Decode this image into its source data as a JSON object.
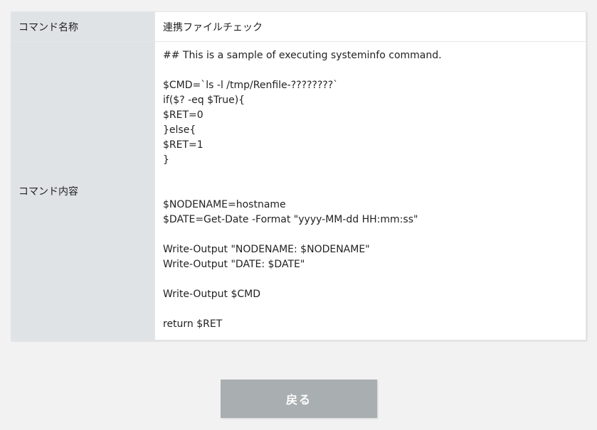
{
  "table": {
    "rows": [
      {
        "label": "コマンド名称",
        "value": "連携ファイルチェック"
      },
      {
        "label": "コマンド内容",
        "value": "## This is a sample of executing systeminfo command.\n\n$CMD=`ls -l /tmp/Renfile-????????`\nif($? -eq $True){\n$RET=0\n}else{\n$RET=1\n}\n\n\n$NODENAME=hostname\n$DATE=Get-Date -Format \"yyyy-MM-dd HH:mm:ss\"\n\nWrite-Output \"NODENAME: $NODENAME\"\nWrite-Output \"DATE: $DATE\"\n\nWrite-Output $CMD\n\nreturn $RET"
      }
    ]
  },
  "back_button": {
    "label": "戻る"
  },
  "colors": {
    "page_background": "#f2f2f2",
    "label_background": "#dfe3e6",
    "button_background": "#a9aeb0"
  }
}
